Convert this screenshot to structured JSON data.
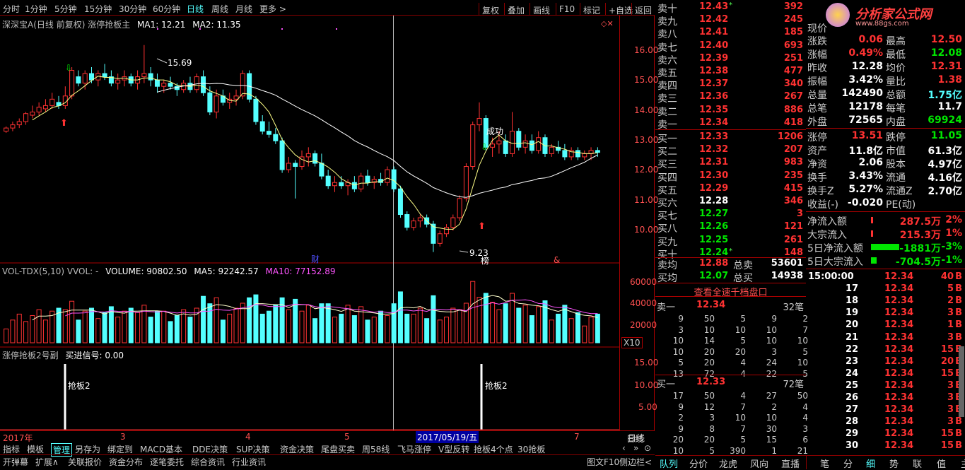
{
  "topbar": {
    "periods": [
      "分时",
      "1分钟",
      "5分钟",
      "15分钟",
      "30分钟",
      "60分钟",
      "日线",
      "周线",
      "月线",
      "更多 >"
    ],
    "buttons": [
      "复权",
      "叠加",
      "画线",
      "F10",
      "标记",
      "+自选",
      "返回"
    ]
  },
  "main": {
    "title": "深深宝A(日线 前复权) 涨停抢板主",
    "ma1": "MA1: 12.21",
    "ma2": "MA2: 11.35",
    "high_label": "15.69",
    "low_label": "9.23",
    "success_label": "成功",
    "note1": "财",
    "note2": "榜",
    "note3": "&",
    "yticks": [
      "16.00",
      "15.00",
      "14.00",
      "13.00",
      "12.00",
      "11.00",
      "10.00"
    ]
  },
  "vol": {
    "title": "VOL-TDX(5,10) VVOL: -",
    "volume": "VOLUME: 90802.50",
    "ma5": "MA5: 92242.57",
    "ma10": "MA10: 77152.89",
    "yticks": [
      "60000",
      "40000",
      "20000"
    ],
    "unit": "X10"
  },
  "sub": {
    "title": "涨停抢板2号副",
    "signal": "买进信号: 0.00",
    "label1": "抢板2",
    "label2": "抢板2",
    "yticks": [
      "15.00",
      "10.00",
      "5.00"
    ]
  },
  "dateaxis": {
    "labels": [
      "2017年",
      "3",
      "4",
      "5",
      "2017/05/19/五",
      "7"
    ],
    "period": "日线"
  },
  "orderbook": {
    "asks": [
      {
        "l": "卖十",
        "p": "12.43",
        "v": "392",
        "mark": "*"
      },
      {
        "l": "卖九",
        "p": "12.42",
        "v": "245"
      },
      {
        "l": "卖八",
        "p": "12.41",
        "v": "185"
      },
      {
        "l": "卖七",
        "p": "12.40",
        "v": "693"
      },
      {
        "l": "卖六",
        "p": "12.39",
        "v": "251"
      },
      {
        "l": "卖五",
        "p": "12.38",
        "v": "477"
      },
      {
        "l": "卖四",
        "p": "12.37",
        "v": "340"
      },
      {
        "l": "卖三",
        "p": "12.36",
        "v": "267"
      },
      {
        "l": "卖二",
        "p": "12.35",
        "v": "886"
      },
      {
        "l": "卖一",
        "p": "12.34",
        "v": "418"
      }
    ],
    "bids": [
      {
        "l": "买一",
        "p": "12.33",
        "v": "1206"
      },
      {
        "l": "买二",
        "p": "12.32",
        "v": "207"
      },
      {
        "l": "买三",
        "p": "12.31",
        "v": "983"
      },
      {
        "l": "买四",
        "p": "12.30",
        "v": "235"
      },
      {
        "l": "买五",
        "p": "12.29",
        "v": "415"
      },
      {
        "l": "买六",
        "p": "12.28",
        "v": "346"
      },
      {
        "l": "买七",
        "p": "12.27",
        "v": "3"
      },
      {
        "l": "买八",
        "p": "12.26",
        "v": "121"
      },
      {
        "l": "买九",
        "p": "12.25",
        "v": "261"
      },
      {
        "l": "买十",
        "p": "12.24",
        "v": "148",
        "mark": "*"
      }
    ],
    "ask_avg_label": "卖均",
    "ask_avg": "12.88",
    "ask_total_label": "总卖",
    "ask_total": "53601",
    "bid_avg_label": "买均",
    "bid_avg": "12.07",
    "bid_total_label": "总买",
    "bid_total": "14938",
    "fullview": "查看全速千档盘口"
  },
  "qdepth": {
    "sell_label": "卖一",
    "sell_price": "12.34",
    "sell_count": "32笔",
    "sell_rows": [
      [
        "9",
        "50",
        "5",
        "9",
        "2"
      ],
      [
        "3",
        "10",
        "10",
        "10",
        "7"
      ],
      [
        "10",
        "14",
        "5",
        "10",
        "10"
      ],
      [
        "10",
        "20",
        "20",
        "3",
        "5"
      ],
      [
        "5",
        "20",
        "4",
        "24",
        "10"
      ],
      [
        "13",
        "72",
        "4",
        "22",
        "5"
      ]
    ],
    "buy_label": "买一",
    "buy_price": "12.33",
    "buy_count": "72笔",
    "buy_rows": [
      [
        "17",
        "50",
        "4",
        "27",
        "50"
      ],
      [
        "9",
        "12",
        "7",
        "2",
        "4"
      ],
      [
        "2",
        "3",
        "10",
        "10",
        "4"
      ],
      [
        "9",
        "8",
        "7",
        "30",
        "3"
      ],
      [
        "20",
        "20",
        "5",
        "15",
        "6"
      ],
      [
        "10",
        "5",
        "390",
        "1",
        "21"
      ]
    ]
  },
  "logo": {
    "text": "分析家公式网",
    "url": "www.88gs.com"
  },
  "info": {
    "rows": [
      [
        "现价",
        "",
        "",
        ""
      ],
      [
        "涨跌",
        "0.06",
        "最高",
        "12.50"
      ],
      [
        "涨幅",
        "0.49%",
        "最低",
        "12.08"
      ],
      [
        "昨收",
        "12.28",
        "均价",
        "12.31"
      ],
      [
        "振幅",
        "3.42%",
        "量比",
        "1.38"
      ],
      [
        "总量",
        "142490",
        "总额",
        "1.75亿"
      ],
      [
        "总笔",
        "12178",
        "每笔",
        "11.7"
      ],
      [
        "外盘",
        "72565",
        "内盘",
        "69924"
      ],
      [
        "涨停",
        "13.51",
        "跌停",
        "11.05"
      ],
      [
        "资产",
        "11.8亿",
        "市值",
        "61.3亿"
      ],
      [
        "净资",
        "2.06",
        "股本",
        "4.97亿"
      ],
      [
        "换手",
        "3.43%",
        "流通",
        "4.16亿"
      ],
      [
        "换手Z",
        "5.27%",
        "流通Z",
        "2.70亿"
      ],
      [
        "收益(-)",
        "-0.020",
        "PE(动)",
        ""
      ]
    ],
    "flows": [
      [
        "净流入额",
        "287.5万",
        "2%"
      ],
      [
        "大宗流入",
        "215.3万",
        "1%"
      ],
      [
        "5日净流入额",
        "-1881万",
        "-3%"
      ],
      [
        "5日大宗流入",
        "-704.5万",
        "-1%"
      ]
    ]
  },
  "trades": {
    "header": [
      "15:00:00",
      "12.34",
      "40",
      "B"
    ],
    "rows": [
      [
        "17",
        "12.34",
        "5",
        "B"
      ],
      [
        "18",
        "12.34",
        "2",
        "B"
      ],
      [
        "19",
        "12.34",
        "3",
        "B"
      ],
      [
        "20",
        "12.34",
        "1",
        "B"
      ],
      [
        "21",
        "12.34",
        "3",
        "B"
      ],
      [
        "22",
        "12.34",
        "15",
        "B"
      ],
      [
        "23",
        "12.34",
        "20",
        "B"
      ],
      [
        "24",
        "12.34",
        "15",
        "B"
      ],
      [
        "25",
        "12.34",
        "3",
        "B"
      ],
      [
        "26",
        "12.34",
        "3",
        "B"
      ],
      [
        "27",
        "12.34",
        "3",
        "B"
      ],
      [
        "28",
        "12.34",
        "3",
        "B"
      ],
      [
        "29",
        "12.34",
        "15",
        "B"
      ],
      [
        "30",
        "12.34",
        "15",
        "B"
      ]
    ]
  },
  "bottom": {
    "row1": [
      "指标",
      "模板",
      "管理",
      "另存为",
      "绑定到",
      "MACD基本",
      "DDE决策",
      "SUP决策",
      "资金决策",
      "尾盘买卖",
      "周58线",
      "飞马涨停",
      "V型反转",
      "抢板4个点",
      "30抢板"
    ],
    "row2": [
      "开弹幕",
      "扩展∧",
      "关联报价",
      "资金分布",
      "逐笔委托",
      "综合资讯",
      "行业资讯"
    ],
    "tools": [
      "图文F10",
      "侧边栏<"
    ],
    "nav": [
      "日线",
      "‹",
      "»",
      "⊙"
    ]
  },
  "rtabs": [
    "队列",
    "分价",
    "龙虎",
    "风向",
    "直播",
    "笔",
    "分",
    "细",
    "势",
    "联",
    "值",
    "主"
  ],
  "chart_data": {
    "type": "candlestick",
    "title": "深深宝A(日线 前复权) 涨停抢板主",
    "ylim": [
      9,
      16.5
    ],
    "ma1": 12.21,
    "ma2": 11.35,
    "candles": [
      [
        13.0,
        13.15,
        12.95,
        13.1
      ],
      [
        13.1,
        13.3,
        13.0,
        13.2
      ],
      [
        13.2,
        13.4,
        13.1,
        13.3
      ],
      [
        13.3,
        13.6,
        13.2,
        13.55
      ],
      [
        13.5,
        13.8,
        13.4,
        13.6
      ],
      [
        13.6,
        13.9,
        13.5,
        13.75
      ],
      [
        13.7,
        14.0,
        13.6,
        13.8
      ],
      [
        13.8,
        14.2,
        13.7,
        14.0
      ],
      [
        13.9,
        14.1,
        13.7,
        13.8
      ],
      [
        13.8,
        14.4,
        13.7,
        14.1
      ],
      [
        14.1,
        15.0,
        14.0,
        14.9
      ],
      [
        14.7,
        14.9,
        14.4,
        14.5
      ],
      [
        14.5,
        14.9,
        14.3,
        14.8
      ],
      [
        14.8,
        15.0,
        14.5,
        14.6
      ],
      [
        14.6,
        14.9,
        14.4,
        14.8
      ],
      [
        14.8,
        15.1,
        14.6,
        14.7
      ],
      [
        14.7,
        14.9,
        14.4,
        14.5
      ],
      [
        14.5,
        14.8,
        14.3,
        14.6
      ],
      [
        14.6,
        14.9,
        14.4,
        14.7
      ],
      [
        14.7,
        14.8,
        14.4,
        14.5
      ],
      [
        14.5,
        14.9,
        14.3,
        14.7
      ],
      [
        14.7,
        15.69,
        14.5,
        14.8
      ],
      [
        14.8,
        15.0,
        14.4,
        14.6
      ],
      [
        14.6,
        14.8,
        14.2,
        14.4
      ],
      [
        14.4,
        14.6,
        14.2,
        14.5
      ],
      [
        14.5,
        14.7,
        14.3,
        14.4
      ],
      [
        14.4,
        14.5,
        14.1,
        14.3
      ],
      [
        14.3,
        14.6,
        14.2,
        14.5
      ],
      [
        14.5,
        14.7,
        14.2,
        14.3
      ],
      [
        14.3,
        14.8,
        14.2,
        14.7
      ],
      [
        14.7,
        14.9,
        14.1,
        14.2
      ],
      [
        14.2,
        14.4,
        13.5,
        13.6
      ],
      [
        13.6,
        14.3,
        13.4,
        14.1
      ],
      [
        14.1,
        14.3,
        13.8,
        13.9
      ],
      [
        13.9,
        14.2,
        13.7,
        14.0
      ],
      [
        14.0,
        14.3,
        13.8,
        14.1
      ],
      [
        14.1,
        14.9,
        14.0,
        14.8
      ],
      [
        14.8,
        14.9,
        13.9,
        14.0
      ],
      [
        14.0,
        14.1,
        13.2,
        13.3
      ],
      [
        13.3,
        13.5,
        12.9,
        13.0
      ],
      [
        13.0,
        13.3,
        12.8,
        12.9
      ],
      [
        12.9,
        13.1,
        12.6,
        12.7
      ],
      [
        12.7,
        12.8,
        11.7,
        11.8
      ],
      [
        11.8,
        12.2,
        11.7,
        12.0
      ],
      [
        12.0,
        12.1,
        10.9,
        11.9
      ],
      [
        11.9,
        12.4,
        11.8,
        12.2
      ],
      [
        12.2,
        12.5,
        11.9,
        12.3
      ],
      [
        12.3,
        12.4,
        11.9,
        12.0
      ],
      [
        12.0,
        12.3,
        11.5,
        11.6
      ],
      [
        11.6,
        11.8,
        11.2,
        11.3
      ],
      [
        11.3,
        11.6,
        11.1,
        11.4
      ],
      [
        11.4,
        11.6,
        11.2,
        11.3
      ],
      [
        11.3,
        11.5,
        11.0,
        11.4
      ],
      [
        11.4,
        11.6,
        11.1,
        11.2
      ],
      [
        11.2,
        11.7,
        11.1,
        11.6
      ],
      [
        11.6,
        11.8,
        11.3,
        11.4
      ],
      [
        11.4,
        11.6,
        11.2,
        11.5
      ],
      [
        11.5,
        11.7,
        11.3,
        11.4
      ],
      [
        11.4,
        11.9,
        11.3,
        11.8
      ],
      [
        11.8,
        11.9,
        11.1,
        11.2
      ],
      [
        11.2,
        11.3,
        10.3,
        10.4
      ],
      [
        10.4,
        10.5,
        9.9,
        10.0
      ],
      [
        10.0,
        10.3,
        9.9,
        10.2
      ],
      [
        10.2,
        10.4,
        10.0,
        10.3
      ],
      [
        10.3,
        10.4,
        10.0,
        10.1
      ],
      [
        10.1,
        10.2,
        9.23,
        9.5
      ],
      [
        9.5,
        9.9,
        9.4,
        9.8
      ],
      [
        9.8,
        10.1,
        9.7,
        10.0
      ],
      [
        10.0,
        10.4,
        9.9,
        10.3
      ],
      [
        10.3,
        11.0,
        10.2,
        10.9
      ],
      [
        10.9,
        12.0,
        10.8,
        11.9
      ],
      [
        11.9,
        13.3,
        11.8,
        13.2
      ],
      [
        13.2,
        13.9,
        13.0,
        13.4
      ],
      [
        13.4,
        13.5,
        12.4,
        12.5
      ],
      [
        12.5,
        12.8,
        12.2,
        12.6
      ],
      [
        12.6,
        13.0,
        12.3,
        12.7
      ],
      [
        12.7,
        12.9,
        12.2,
        12.3
      ],
      [
        12.3,
        13.6,
        12.2,
        13.0
      ],
      [
        13.0,
        13.1,
        12.4,
        12.5
      ],
      [
        12.5,
        12.9,
        12.3,
        12.7
      ],
      [
        12.7,
        12.9,
        12.3,
        12.4
      ],
      [
        12.4,
        13.0,
        12.3,
        12.8
      ],
      [
        12.8,
        12.9,
        12.2,
        12.3
      ],
      [
        12.3,
        12.6,
        12.2,
        12.5
      ],
      [
        12.5,
        12.7,
        12.3,
        12.4
      ],
      [
        12.4,
        12.6,
        12.1,
        12.2
      ],
      [
        12.2,
        12.5,
        12.1,
        12.4
      ],
      [
        12.4,
        12.5,
        12.1,
        12.2
      ],
      [
        12.2,
        12.4,
        12.1,
        12.3
      ],
      [
        12.3,
        12.5,
        12.1,
        12.4
      ],
      [
        12.4,
        12.5,
        12.2,
        12.34
      ]
    ]
  }
}
